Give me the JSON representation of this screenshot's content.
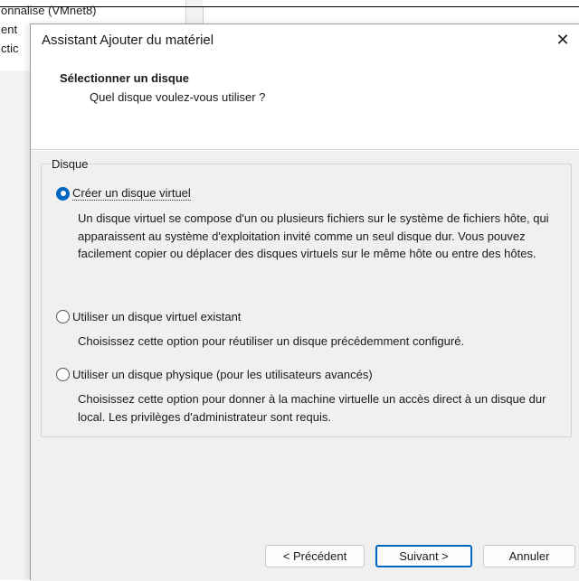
{
  "background": {
    "line1": "onnalise (VMnet8)",
    "line2": "ent",
    "line3": "ctic"
  },
  "dialog": {
    "title": "Assistant Ajouter du matériel",
    "close_glyph": "✕"
  },
  "header": {
    "title": "Sélectionner un disque",
    "subtitle": "Quel disque voulez-vous utiliser ?"
  },
  "group": {
    "legend": "Disque",
    "options": [
      {
        "label": "Créer un disque virtuel",
        "selected": true,
        "description": "Un disque virtuel se compose d'un ou plusieurs fichiers sur le système de fichiers hôte, qui apparaissent au système d'exploitation invité comme un seul disque dur. Vous pouvez facilement copier ou déplacer des disques virtuels sur le même hôte ou entre des hôtes."
      },
      {
        "label": "Utiliser un disque virtuel existant",
        "selected": false,
        "description": "Choisissez cette option pour réutiliser un disque précédemment configuré."
      },
      {
        "label": "Utiliser un disque physique (pour les utilisateurs avancés)",
        "selected": false,
        "description": "Choisissez cette option pour donner à la machine virtuelle un accès direct à un disque dur local. Les privilèges d'administrateur sont requis."
      }
    ]
  },
  "buttons": {
    "back": "< Précédent",
    "next": "Suivant >",
    "cancel": "Annuler"
  }
}
